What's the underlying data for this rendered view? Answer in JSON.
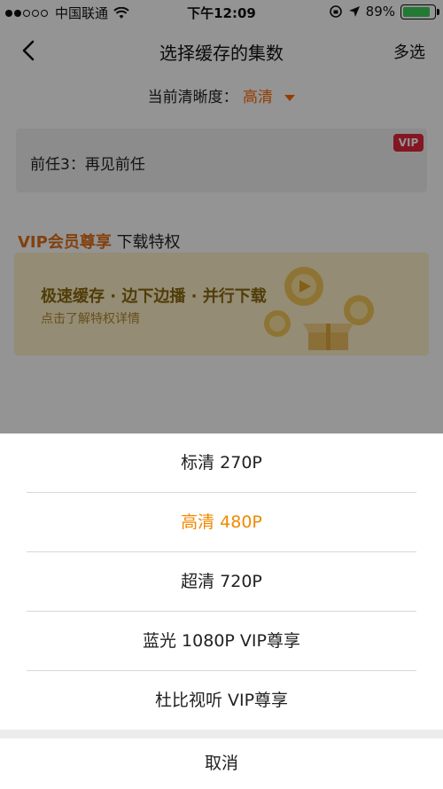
{
  "status_bar": {
    "carrier": "中国联通",
    "time": "下午12:09",
    "battery_percent_text": "89%",
    "battery_level": 0.89
  },
  "nav": {
    "back_icon": "chevron-left-icon",
    "title": "选择缓存的集数",
    "multi_select": "多选"
  },
  "quality": {
    "label": "当前清晰度：",
    "value": "高清"
  },
  "episode": {
    "title": "前任3：再见前任",
    "badge": "VIP"
  },
  "vip_section": {
    "highlight": "VIP会员尊享",
    "rest": "下载特权"
  },
  "vip_banner": {
    "title": "极速缓存 · 边下边播 · 并行下载",
    "subtitle": "点击了解特权详情"
  },
  "sheet": {
    "options": [
      {
        "label": "标清 270P"
      },
      {
        "label": "高清 480P",
        "selected": true
      },
      {
        "label": "超清 720P"
      },
      {
        "label": "蓝光 1080P VIP尊享"
      },
      {
        "label": "杜比视听 VIP尊享"
      }
    ],
    "cancel": "取消"
  },
  "colors": {
    "accent_orange": "#ff6a00",
    "selected_option": "#f08a00",
    "vip_red": "#e3273b",
    "battery_green": "#3fd15a"
  }
}
